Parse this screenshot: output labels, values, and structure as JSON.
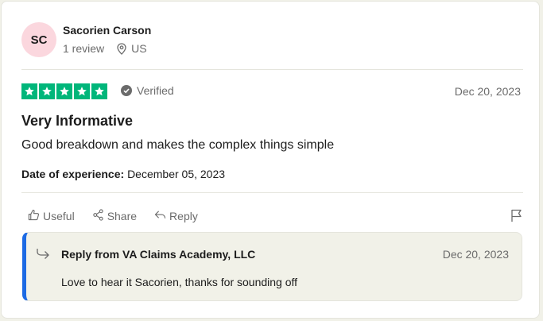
{
  "reviewer": {
    "initials": "SC",
    "name": "Sacorien Carson",
    "review_count": "1 review",
    "country": "US"
  },
  "review": {
    "rating": 5,
    "rating_max": 5,
    "verified_label": "Verified",
    "date": "Dec 20, 2023",
    "title": "Very Informative",
    "body": "Good breakdown and makes the complex things simple",
    "experience_label": "Date of experience:",
    "experience_date": "December 05, 2023"
  },
  "actions": {
    "useful": "Useful",
    "share": "Share",
    "reply": "Reply"
  },
  "company_reply": {
    "from": "Reply from VA Claims Academy, LLC",
    "date": "Dec 20, 2023",
    "text": "Love to hear it Sacorien, thanks for sounding off"
  },
  "colors": {
    "star_green": "#00b67a",
    "avatar_pink": "#fbd7de",
    "reply_accent": "#1c6ae4",
    "reply_bg": "#f1f1e8"
  }
}
